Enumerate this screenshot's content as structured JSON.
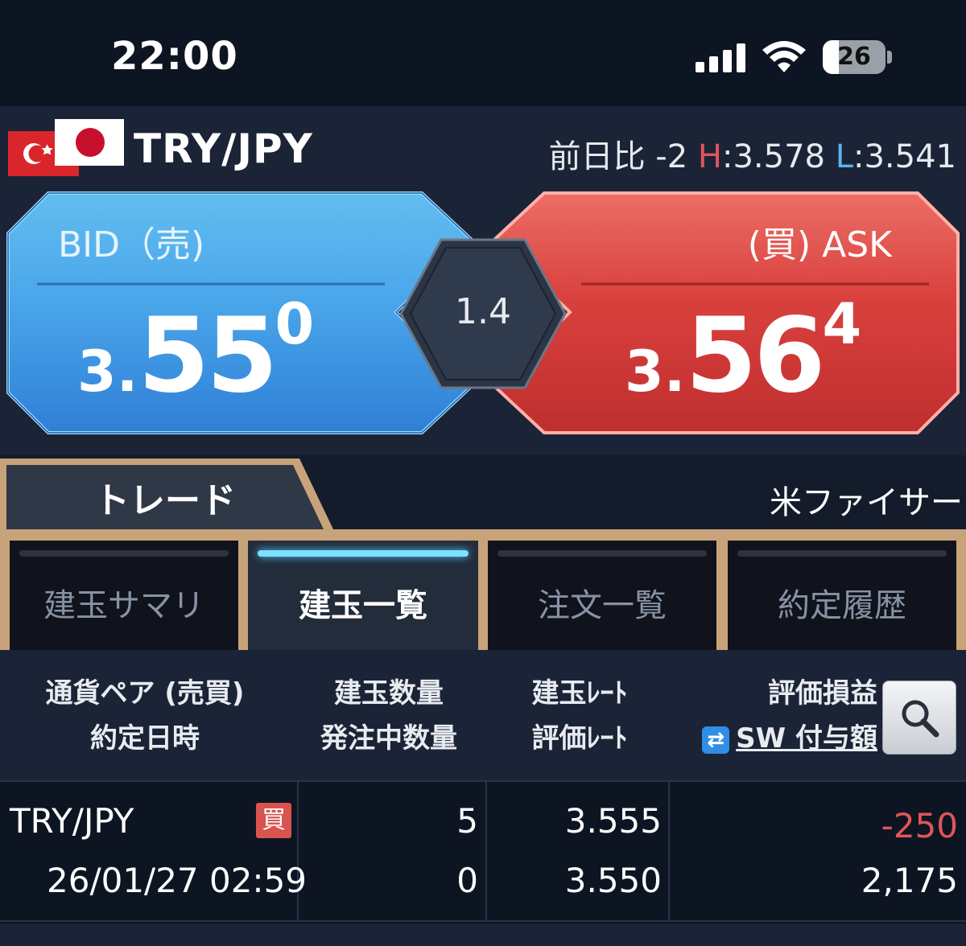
{
  "status_bar": {
    "time": "22:00",
    "battery": "26",
    "battery_level": 0.26
  },
  "pair_header": {
    "pair": "TRY/JPY",
    "change_label": "前日比",
    "change_value": "-2",
    "high_letter": "H",
    "high_value": ":3.578",
    "low_letter": "L",
    "low_value": ":3.541"
  },
  "quote": {
    "bid_label": "BID（売)",
    "bid_price_small": "3.",
    "bid_price_big": "55",
    "bid_price_sup": "0",
    "ask_label": "(買) ASK",
    "ask_price_small": "3.",
    "ask_price_big": "56",
    "ask_price_sup": "4",
    "spread": "1.4"
  },
  "main_tabs": {
    "trade_label": "トレード",
    "ticker_text": "米ファイサー"
  },
  "sub_tabs": [
    {
      "label": "建玉サマリ",
      "active": false
    },
    {
      "label": "建玉一覧",
      "active": true
    },
    {
      "label": "注文一覧",
      "active": false
    },
    {
      "label": "約定履歴",
      "active": false
    }
  ],
  "table_header": {
    "col1_line1": "通貨ペア (売買)",
    "col1_line2": "約定日時",
    "col2_line1": "建玉数量",
    "col2_line2": "発注中数量",
    "col3_line1": "建玉ﾚｰﾄ",
    "col3_line2": "評価ﾚｰﾄ",
    "col4_line1": "評価損益",
    "col4_line2": "SW 付与額"
  },
  "rows": [
    {
      "pair": "TRY/JPY",
      "side": "買",
      "datetime": "26/01/27 02:59",
      "quantity": "5",
      "pending_quantity": "0",
      "open_rate": "3.555",
      "eval_rate": "3.550",
      "pnl": "-250",
      "swap": "2,175"
    }
  ],
  "colors": {
    "bid_blue": "#4aa6ea",
    "ask_red": "#d9403d",
    "loss_red": "#e0555a",
    "gold_frame": "#c8a37a"
  }
}
